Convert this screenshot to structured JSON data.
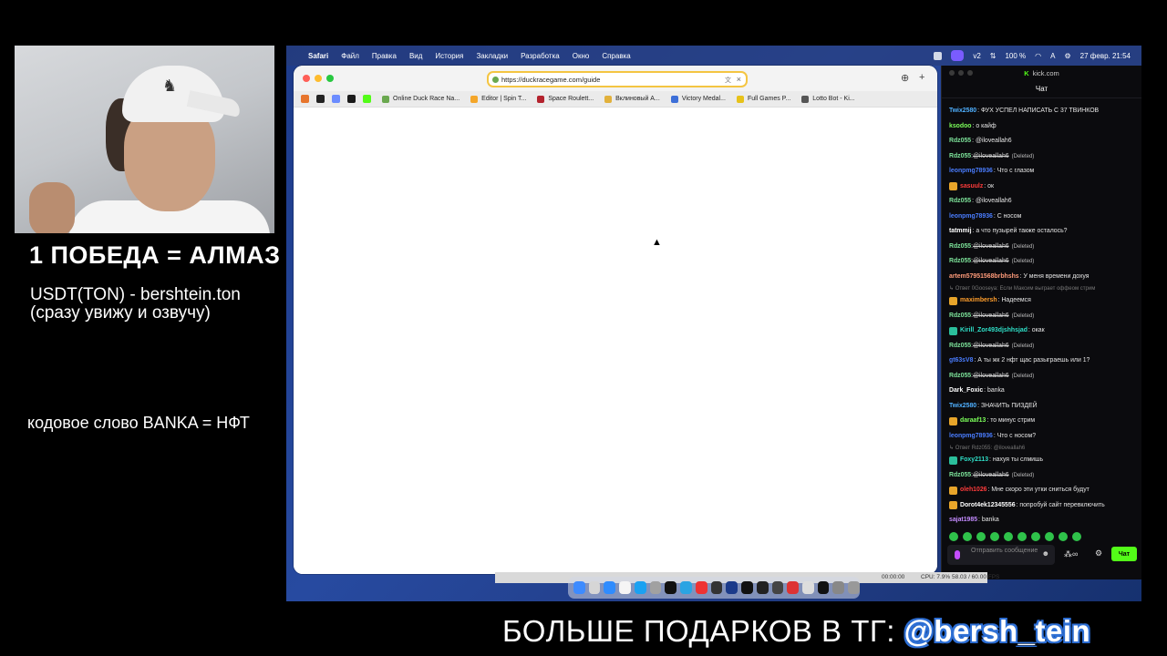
{
  "overlay": {
    "title": "1 ПОБЕДА = АЛМАЗ",
    "line1": "USDT(TON) - bershtein.ton",
    "line2": "(сразу увижу и озвучу)",
    "code": "кодовое слово BANKA = НФТ"
  },
  "banner": {
    "text": "БОЛЬШЕ ПОДАРКОВ В ТГ: ",
    "handle": "@bersh_tein"
  },
  "menubar": {
    "apple": "",
    "app": "Safari",
    "items": [
      "Файл",
      "Правка",
      "Вид",
      "История",
      "Закладки",
      "Разработка",
      "Окно",
      "Справка"
    ],
    "battery": "100 %",
    "datetime": "27 февр.  21:54",
    "v2": "v2"
  },
  "safari": {
    "url": "https://duckracegame.com/guide",
    "tabs": [
      {
        "label": "Online Duck Race Na...",
        "color": "#6aa84f"
      },
      {
        "label": "Editor | Spin T...",
        "color": "#f4a62a"
      },
      {
        "label": "Space Roulett...",
        "color": "#b4232e"
      },
      {
        "label": "Вклиновый А...",
        "color": "#e2b13c"
      },
      {
        "label": "Victory Medal...",
        "color": "#3d6fd8"
      },
      {
        "label": "Full Games P...",
        "color": "#e7c21a"
      },
      {
        "label": "Lotto Bot - Ki...",
        "color": "#555555"
      }
    ],
    "bookmark_colors": [
      "#e7752d",
      "#222222",
      "#6b8cff",
      "#1a1a1a",
      "#53fc18"
    ]
  },
  "chat": {
    "site": "kick.com",
    "header": "Чат",
    "input_placeholder": "Отправить сообщение",
    "send_label": "Чат",
    "messages": [
      {
        "type": "msg",
        "user": "Twix2580",
        "color": "#4fb0ff",
        "text": ": ФУХ УСПЕЛ НАПИСАТЬ С 37 ТВИНКОВ"
      },
      {
        "type": "msg",
        "user": "ksodoo",
        "color": "#7cff5a",
        "text": ": о кайф"
      },
      {
        "type": "msg",
        "user": "Rdz055",
        "color": "#7de39a",
        "text": ": @iloveallah6"
      },
      {
        "type": "msg",
        "user": "Rdz055",
        "color": "#7de39a",
        "mention": "@iloveallah6",
        "deleted": "(Deleted)"
      },
      {
        "type": "msg",
        "user": "leonpmg78936",
        "color": "#4a7dff",
        "text": ": Что с глазом"
      },
      {
        "type": "msg",
        "user": "sasuulz",
        "color": "#ff3b3b",
        "badge": "y",
        "text": ": ок"
      },
      {
        "type": "msg",
        "user": "Rdz055",
        "color": "#7de39a",
        "text": ": @iloveallah6"
      },
      {
        "type": "msg",
        "user": "leonpmg78936",
        "color": "#4a7dff",
        "text": ": С носом"
      },
      {
        "type": "msg",
        "user": "tatmmij",
        "color": "#ffffff",
        "text": ": а что пузырей также осталось?"
      },
      {
        "type": "msg",
        "user": "Rdz055",
        "color": "#7de39a",
        "mention": "@iloveallah6",
        "deleted": "(Deleted)"
      },
      {
        "type": "msg",
        "user": "Rdz055",
        "color": "#7de39a",
        "mention": "@iloveallah6",
        "deleted": "(Deleted)"
      },
      {
        "type": "msg",
        "user": "artem57951568brbhshs",
        "color": "#ff9b7a",
        "text": ": У меня времени дохуя"
      },
      {
        "type": "reply",
        "text": "↳ Ответ 0Gooseya: Если Максим выграет оффеом стрим"
      },
      {
        "type": "msg",
        "user": "maximbersh",
        "color": "#ff9e2c",
        "badge": "y",
        "text": ": Надеемся"
      },
      {
        "type": "msg",
        "user": "Rdz055",
        "color": "#7de39a",
        "mention": "@iloveallah6",
        "deleted": "(Deleted)"
      },
      {
        "type": "msg",
        "user": "Kirill_Zor493djshhsjad",
        "color": "#2fe0c8",
        "badge": "g",
        "text": ": окак"
      },
      {
        "type": "msg",
        "user": "Rdz055",
        "color": "#7de39a",
        "mention": "@iloveallah6",
        "deleted": "(Deleted)"
      },
      {
        "type": "msg",
        "user": "gt63sV8",
        "color": "#4a7dff",
        "text": ": А ты жк 2 нфт щас разыграешь или 1?"
      },
      {
        "type": "msg",
        "user": "Rdz055",
        "color": "#7de39a",
        "mention": "@iloveallah6",
        "deleted": "(Deleted)"
      },
      {
        "type": "msg",
        "user": "Dark_Foxic",
        "color": "#ffffff",
        "text": ": banka"
      },
      {
        "type": "msg",
        "user": "Twix2580",
        "color": "#4fb0ff",
        "text": ": ЗНАЧИТЬ ПИЗДЕЙ"
      },
      {
        "type": "msg",
        "user": "daraaf13",
        "color": "#7cff5a",
        "badge": "y",
        "text": ": то минус стрим"
      },
      {
        "type": "msg",
        "user": "leonpmg78936",
        "color": "#4a7dff",
        "text": ": Что с носом?"
      },
      {
        "type": "reply",
        "text": "↳ Ответ Rdz055: @iloveallah6"
      },
      {
        "type": "msg",
        "user": "Foxy2113",
        "color": "#2fe0c8",
        "badge": "g",
        "text": ": нахуя ты слмишь"
      },
      {
        "type": "msg",
        "user": "Rdz055",
        "color": "#7de39a",
        "mention": "@iloveallah6",
        "deleted": "(Deleted)"
      },
      {
        "type": "msg",
        "user": "oleh1026",
        "color": "#ff3b3b",
        "badge": "y",
        "text": ": Мне скоро эти утки сниться будут"
      },
      {
        "type": "msg",
        "user": "Dorot4ek12345556",
        "color": "#ffffff",
        "badge": "y",
        "text": ": попробуй сайт перевключить"
      },
      {
        "type": "msg",
        "user": "sajat1985",
        "color": "#c48bff",
        "text": ": banka"
      }
    ]
  },
  "obs": {
    "time": "00:00:00",
    "cpu": "CPU: 7.9%",
    "fps": "58.03 / 60.00 FPS"
  },
  "dock_colors": [
    "#3d8bff",
    "#d6d6d6",
    "#2f8cff",
    "#f5f5f5",
    "#1aa1f2",
    "#a1a1a1",
    "#111",
    "#2aa4e3",
    "#e33",
    "#333",
    "#1b3a8a",
    "#111",
    "#222",
    "#444",
    "#d33",
    "#ddd",
    "#111",
    "#888",
    "#999"
  ]
}
